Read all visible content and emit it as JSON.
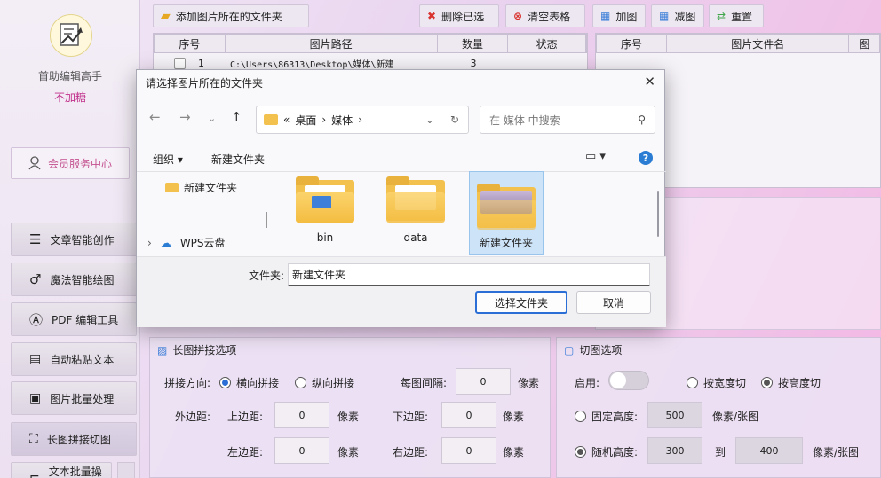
{
  "app": {
    "name": "首助编辑高手",
    "subtitle": "不加糖",
    "member_center": "会员服务中心"
  },
  "nav": [
    {
      "label": "文章智能创作",
      "icon": "list-icon"
    },
    {
      "label": "魔法智能绘图",
      "icon": "brush-icon"
    },
    {
      "label": "PDF 编辑工具",
      "icon": "pdf-icon"
    },
    {
      "label": "自动粘贴文本",
      "icon": "paste-icon"
    },
    {
      "label": "图片批量处理",
      "icon": "image-batch-icon"
    },
    {
      "label": "长图拼接切图",
      "icon": "stitch-icon"
    },
    {
      "label": "文本批量操作",
      "icon": "text-batch-icon"
    }
  ],
  "toolbar": {
    "add_folder": "添加图片所在的文件夹",
    "delete_selected": "删除已选",
    "clear_table": "清空表格",
    "add_image": "加图",
    "remove_image": "减图",
    "reset": "重置"
  },
  "left_table": {
    "headers": [
      "序号",
      "图片路径",
      "数量",
      "状态"
    ],
    "rows": [
      {
        "index": "1",
        "path": "C:\\Users\\86313\\Desktop\\媒体\\新建",
        "count": "3",
        "status": ""
      }
    ]
  },
  "right_table": {
    "headers": [
      "序号",
      "图片文件名",
      "图"
    ]
  },
  "stitch_panel": {
    "title": "长图拼接选项",
    "direction_label": "拼接方向:",
    "horizontal": "横向拼接",
    "vertical": "纵向拼接",
    "spacing_label": "每图间隔:",
    "spacing_value": "0",
    "unit": "像素",
    "margin_label": "外边距:",
    "top_label": "上边距:",
    "top_value": "0",
    "bottom_label": "下边距:",
    "bottom_value": "0",
    "left_label": "左边距:",
    "left_value": "0",
    "right_label": "右边距:",
    "right_value": "0"
  },
  "cut_panel": {
    "title": "切图选项",
    "enable_label": "启用:",
    "by_width": "按宽度切",
    "by_height": "按高度切",
    "fixed_height": "固定高度:",
    "fixed_value": "500",
    "per_image_unit": "像素/张图",
    "random_height": "随机高度:",
    "random_from": "300",
    "to_label": "到",
    "random_to": "400"
  },
  "dialog": {
    "title": "请选择图片所在的文件夹",
    "breadcrumb": [
      "«",
      "桌面",
      "›",
      "媒体",
      "›"
    ],
    "search_placeholder": "在 媒体 中搜索",
    "organize": "组织 ▾",
    "new_folder": "新建文件夹",
    "tree": [
      {
        "label": "新建文件夹"
      },
      {
        "label": "WPS云盘"
      }
    ],
    "folders": [
      {
        "name": "bin"
      },
      {
        "name": "data"
      },
      {
        "name": "新建文件夹"
      }
    ],
    "folder_label": "文件夹:",
    "folder_value": "新建文件夹",
    "select_button": "选择文件夹",
    "cancel_button": "取消"
  },
  "colors": {
    "accent": "#2b6fd6",
    "brand_pink": "#c02e8a",
    "delete_red": "#d9332f"
  }
}
